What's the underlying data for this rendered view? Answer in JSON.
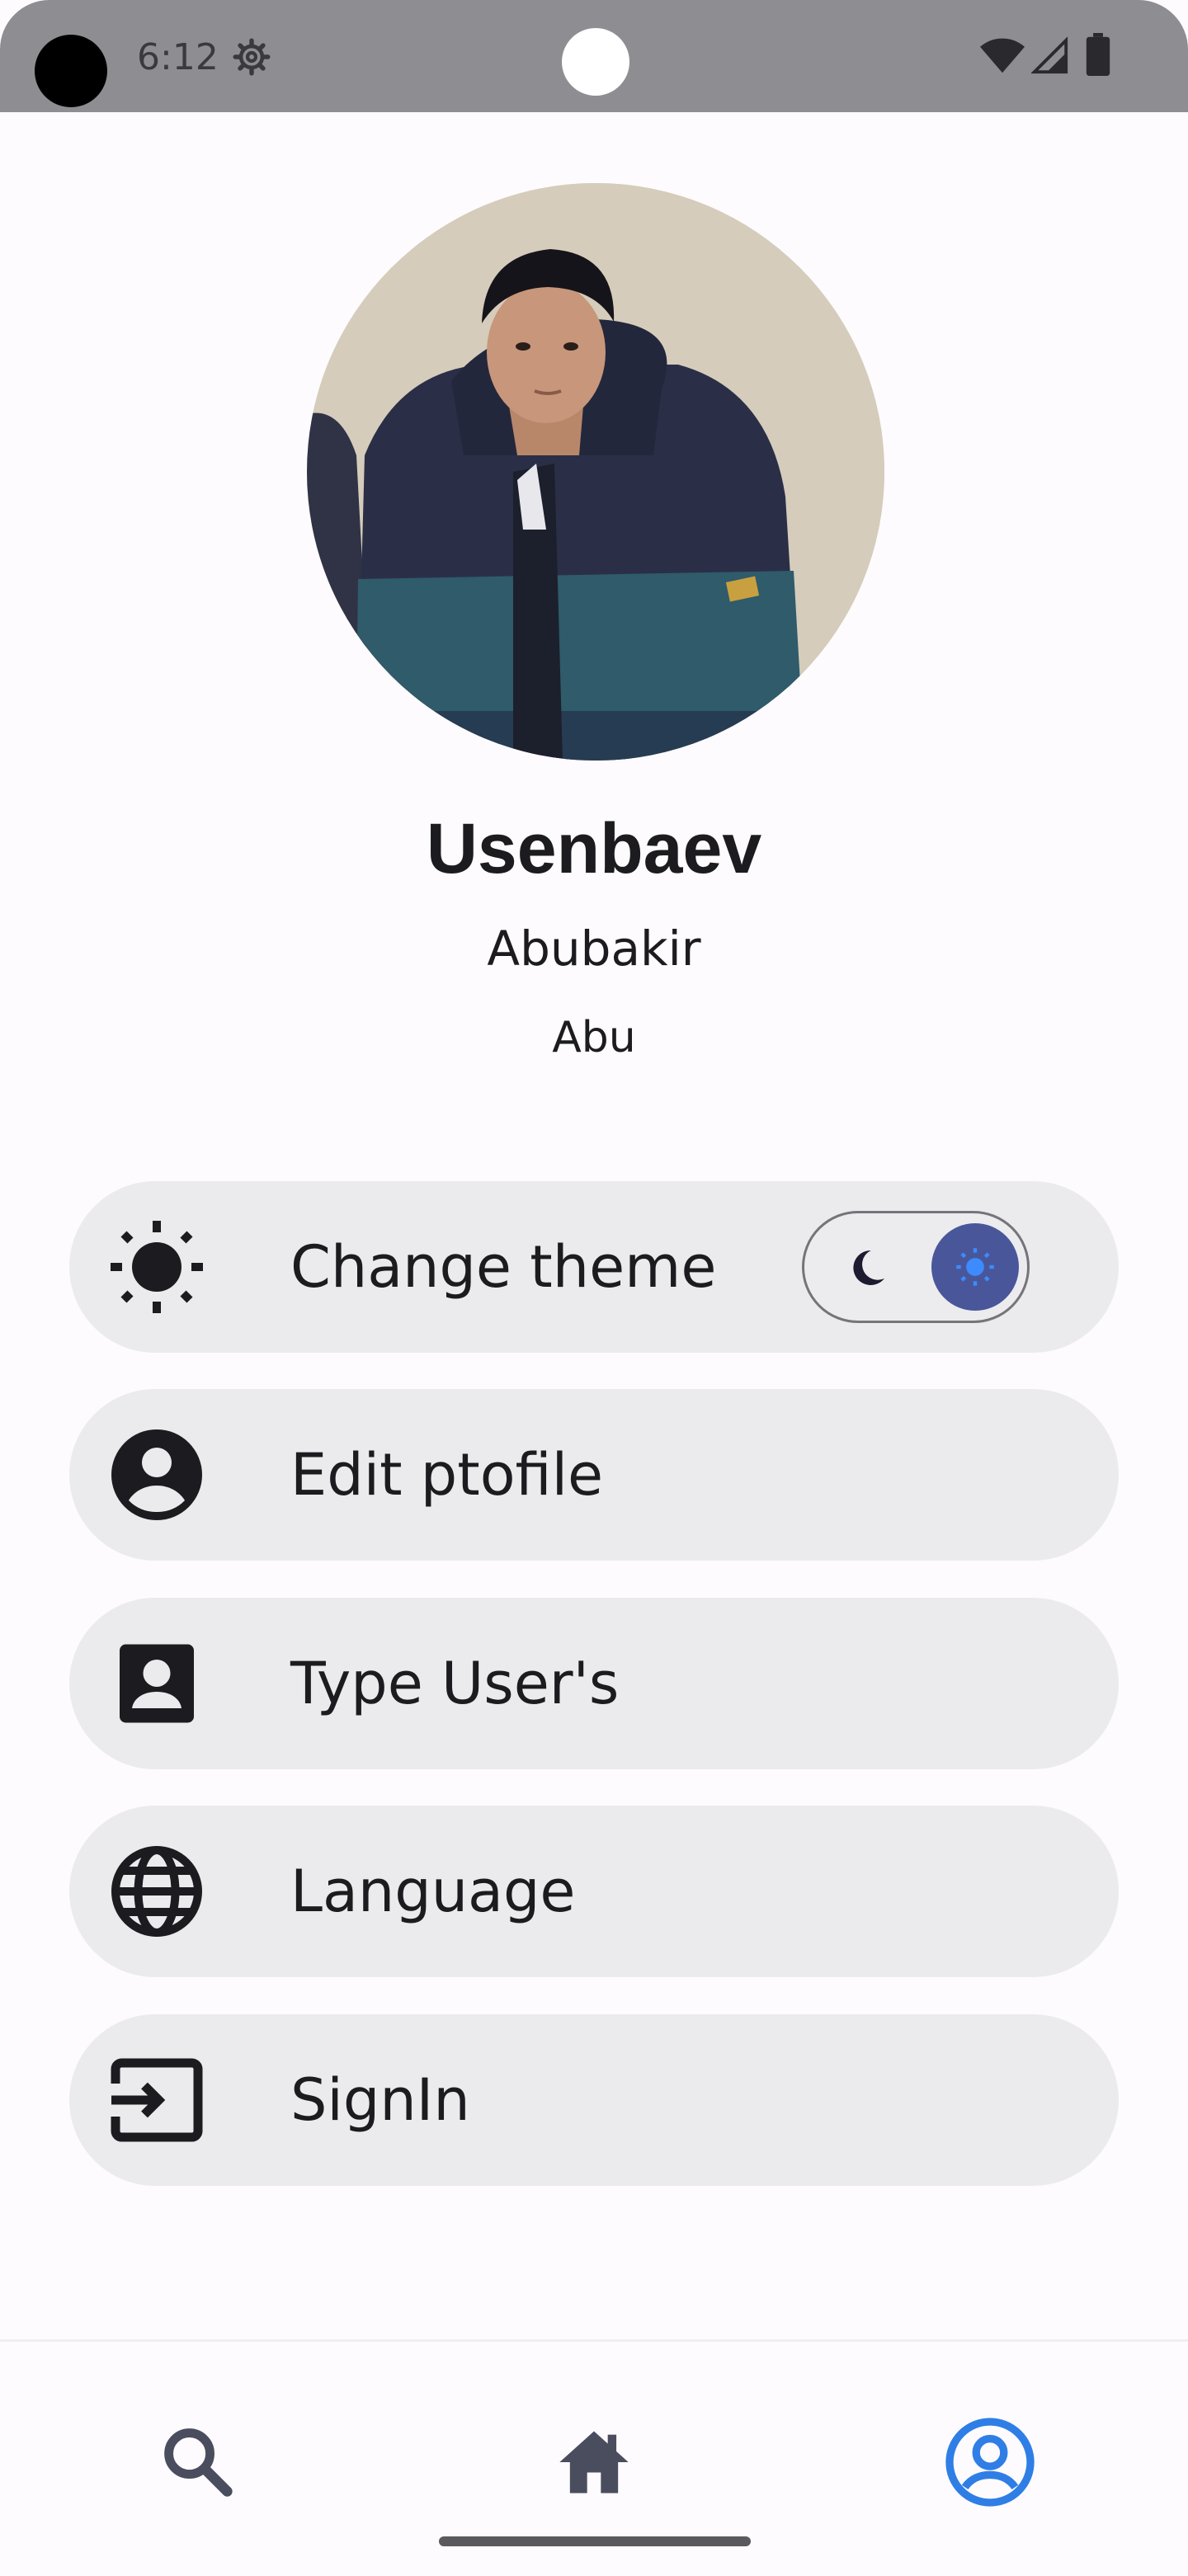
{
  "status_bar": {
    "time": "6:12",
    "icons": [
      "gear-icon",
      "wifi-icon",
      "signal-icon",
      "battery-icon"
    ]
  },
  "profile": {
    "surname": "Usenbaev",
    "first_name": "Abubakir",
    "nickname": "Abu"
  },
  "menu": {
    "items": [
      {
        "label": "Change theme",
        "icon": "sun-icon"
      },
      {
        "label": "Edit ptofile",
        "icon": "account-circle-icon"
      },
      {
        "label": "Type User's",
        "icon": "contact-card-icon"
      },
      {
        "label": "Language",
        "icon": "globe-icon"
      },
      {
        "label": "SignIn",
        "icon": "sign-in-icon"
      }
    ],
    "theme_toggle": {
      "selected": "light",
      "options": [
        "moon-icon",
        "sun-icon"
      ]
    }
  },
  "bottom_nav": {
    "items": [
      "search-icon",
      "home-icon",
      "profile-icon"
    ],
    "active": "profile-icon"
  },
  "colors": {
    "background": "#fdfbfd",
    "menu_item": "#ebebed",
    "toggle_thumb": "#49579a",
    "active_nav": "#2f7ee6",
    "status_bar": "#8e8d92"
  }
}
